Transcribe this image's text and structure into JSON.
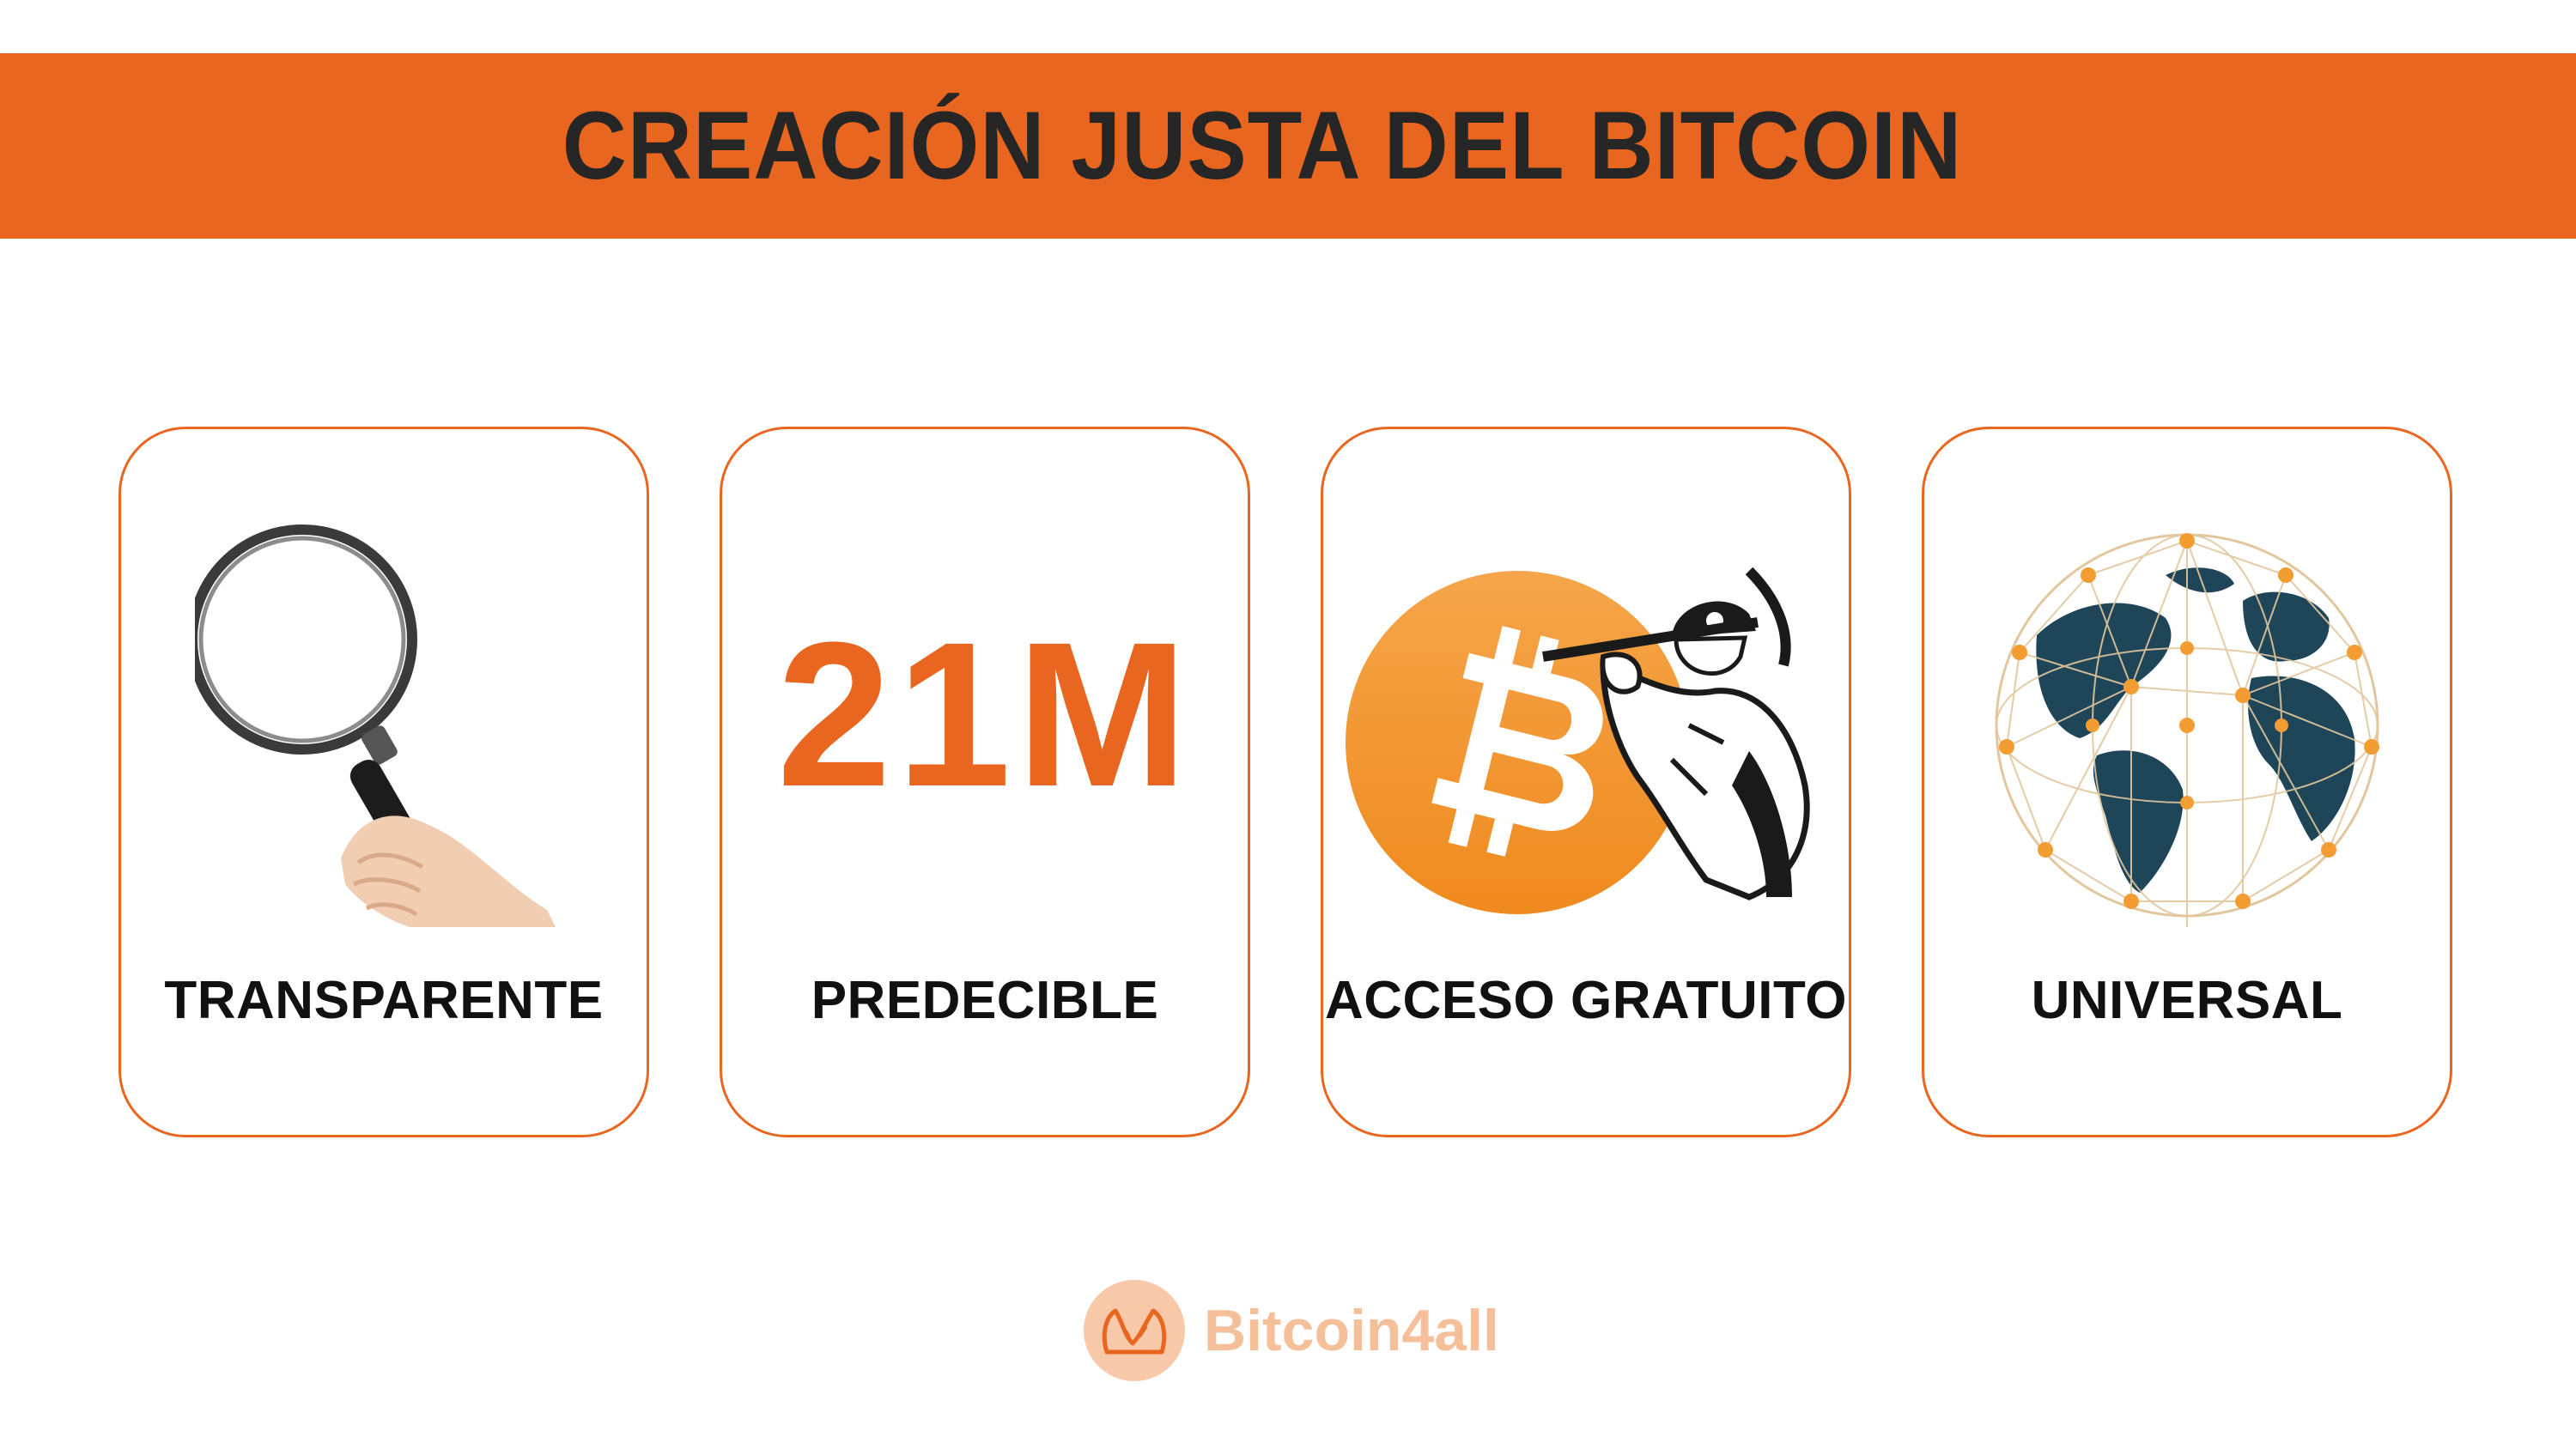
{
  "title": "CREACIÓN JUSTA DEL BITCOIN",
  "cards": [
    {
      "label": "TRANSPARENTE",
      "icon": "magnifying-glass-icon"
    },
    {
      "label": "PREDECIBLE",
      "icon": "21m-supply-text",
      "figure_text": "21M"
    },
    {
      "label": "ACCESO GRATUITO",
      "icon": "bitcoin-miner-icon"
    },
    {
      "label": "UNIVERSAL",
      "icon": "globe-network-icon"
    }
  ],
  "footer": {
    "brand": "Bitcoin4all",
    "icon": "hands-logo-icon"
  },
  "colors": {
    "accent": "#e8661f",
    "bitcoin_orange": "#f39c32",
    "globe_land": "#1f4559",
    "text": "#262626"
  }
}
